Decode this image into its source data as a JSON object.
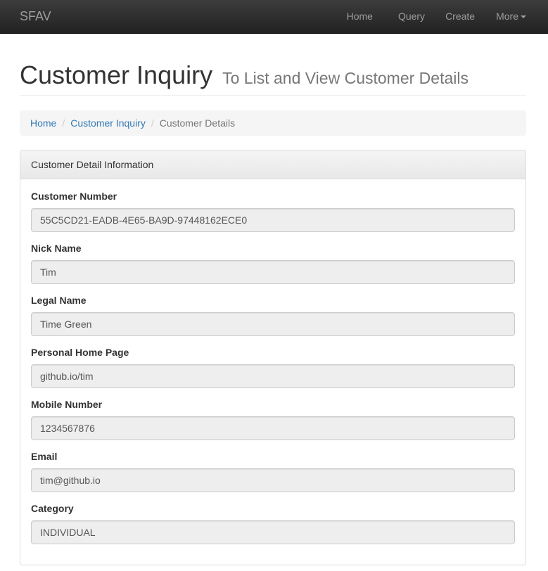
{
  "navbar": {
    "brand": "SFAV",
    "items": [
      {
        "label": "Home"
      },
      {
        "label": "Query"
      },
      {
        "label": "Create"
      },
      {
        "label": "More"
      }
    ]
  },
  "header": {
    "title": "Customer Inquiry",
    "subtitle": "To List and View Customer Details"
  },
  "breadcrumb": {
    "home": "Home",
    "inquiry": "Customer Inquiry",
    "current": "Customer Details"
  },
  "panel": {
    "heading": "Customer Detail Information",
    "fields": [
      {
        "label": "Customer Number",
        "value": "55C5CD21-EADB-4E65-BA9D-97448162ECE0"
      },
      {
        "label": "Nick Name",
        "value": "Tim"
      },
      {
        "label": "Legal Name",
        "value": "Time Green"
      },
      {
        "label": "Personal Home Page",
        "value": "github.io/tim"
      },
      {
        "label": "Mobile Number",
        "value": "1234567876"
      },
      {
        "label": "Email",
        "value": "tim@github.io"
      },
      {
        "label": "Category",
        "value": "INDIVIDUAL"
      }
    ]
  },
  "colors": {
    "navbar_bg": "#222222",
    "link": "#337ab7",
    "readonly_field_bg": "#eeeeee"
  },
  "icons": {
    "more_dropdown": "caret-down-icon"
  }
}
